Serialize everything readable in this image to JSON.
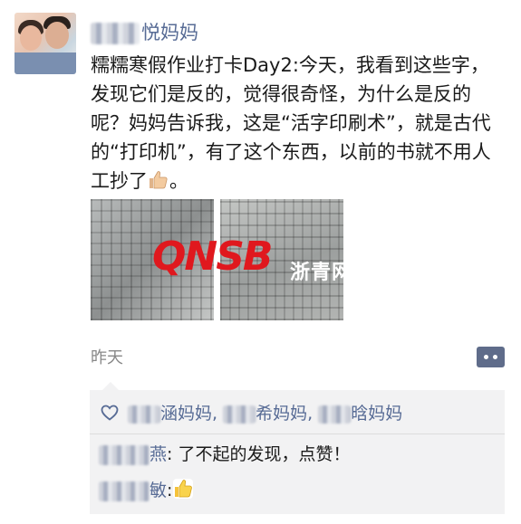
{
  "post": {
    "author_name": "悦妈妈",
    "text": "糯糯寒假作业打卡Day2:今天，我看到这些字，发现它们是反的，觉得很奇怪，为什么是反的呢？妈妈告诉我，这是“活字印刷术”，就是古代的“打印机”，有了这个东西，以前的书就不用人工抄了",
    "text_end": "。",
    "time": "昨天"
  },
  "watermark": {
    "logo": "QNSB",
    "brand": "浙青网"
  },
  "likes": {
    "names": [
      "涵妈妈",
      "希妈妈",
      "晗妈妈"
    ],
    "separator": ", "
  },
  "comments": [
    {
      "name": "燕",
      "colon": ": ",
      "text": "了不起的发现，点赞！"
    },
    {
      "name": "敏",
      "colon": ":",
      "text": ""
    }
  ],
  "icons": {
    "thumbs": "thumbs-up-emoji",
    "heart": "heart-outline-icon",
    "more": "more-dots-icon"
  }
}
